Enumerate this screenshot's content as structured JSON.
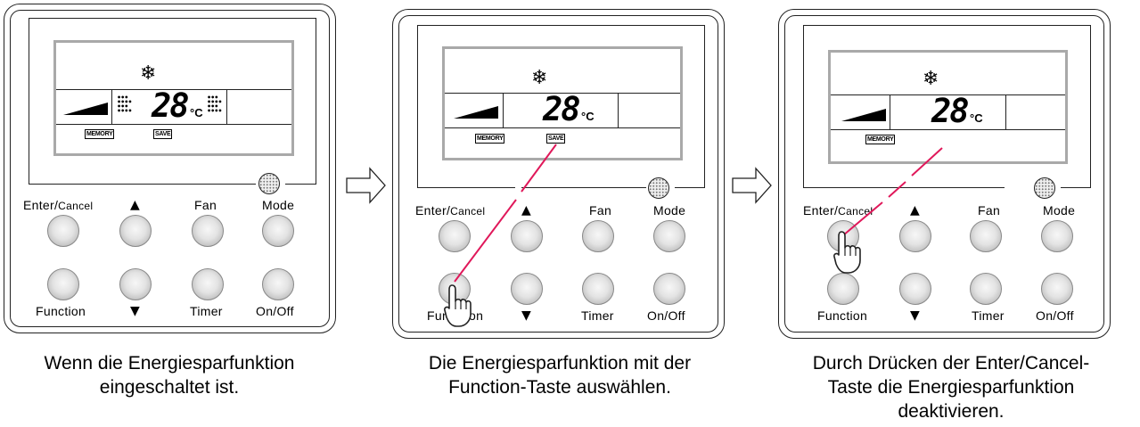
{
  "remote": {
    "snow_icon": "❄",
    "temperature": "28",
    "unit": "°C",
    "memory_tag": "MEMORY",
    "save_tag": "SAVE",
    "buttons": {
      "enter_cancel_main": "Enter/",
      "enter_cancel_small": "Cancel",
      "up_arrow": "▲",
      "fan": "Fan",
      "mode": "Mode",
      "function": "Function",
      "down_arrow": "▼",
      "timer": "Timer",
      "on_off": "On/Off"
    },
    "function_partial_left": "Fun",
    "function_partial_right": "on"
  },
  "captions": {
    "panel1": [
      "Wenn die Energiesparfunktion",
      "eingeschaltet ist."
    ],
    "panel2": [
      "Die Energiesparfunktion mit der",
      "Function-Taste auswählen."
    ],
    "panel3": [
      "Durch Drücken der Enter/Cancel-",
      "Taste die Energiesparfunktion",
      "deaktivieren."
    ]
  },
  "colors": {
    "highlight_line": "#e0185a",
    "lcd_frame": "#a9a9a9"
  },
  "icons": [
    "snowflake-icon",
    "fan-level-icon",
    "airflow-left-icon",
    "airflow-right-icon",
    "speaker-icon",
    "hand-pointer-icon",
    "flow-arrow-icon"
  ]
}
